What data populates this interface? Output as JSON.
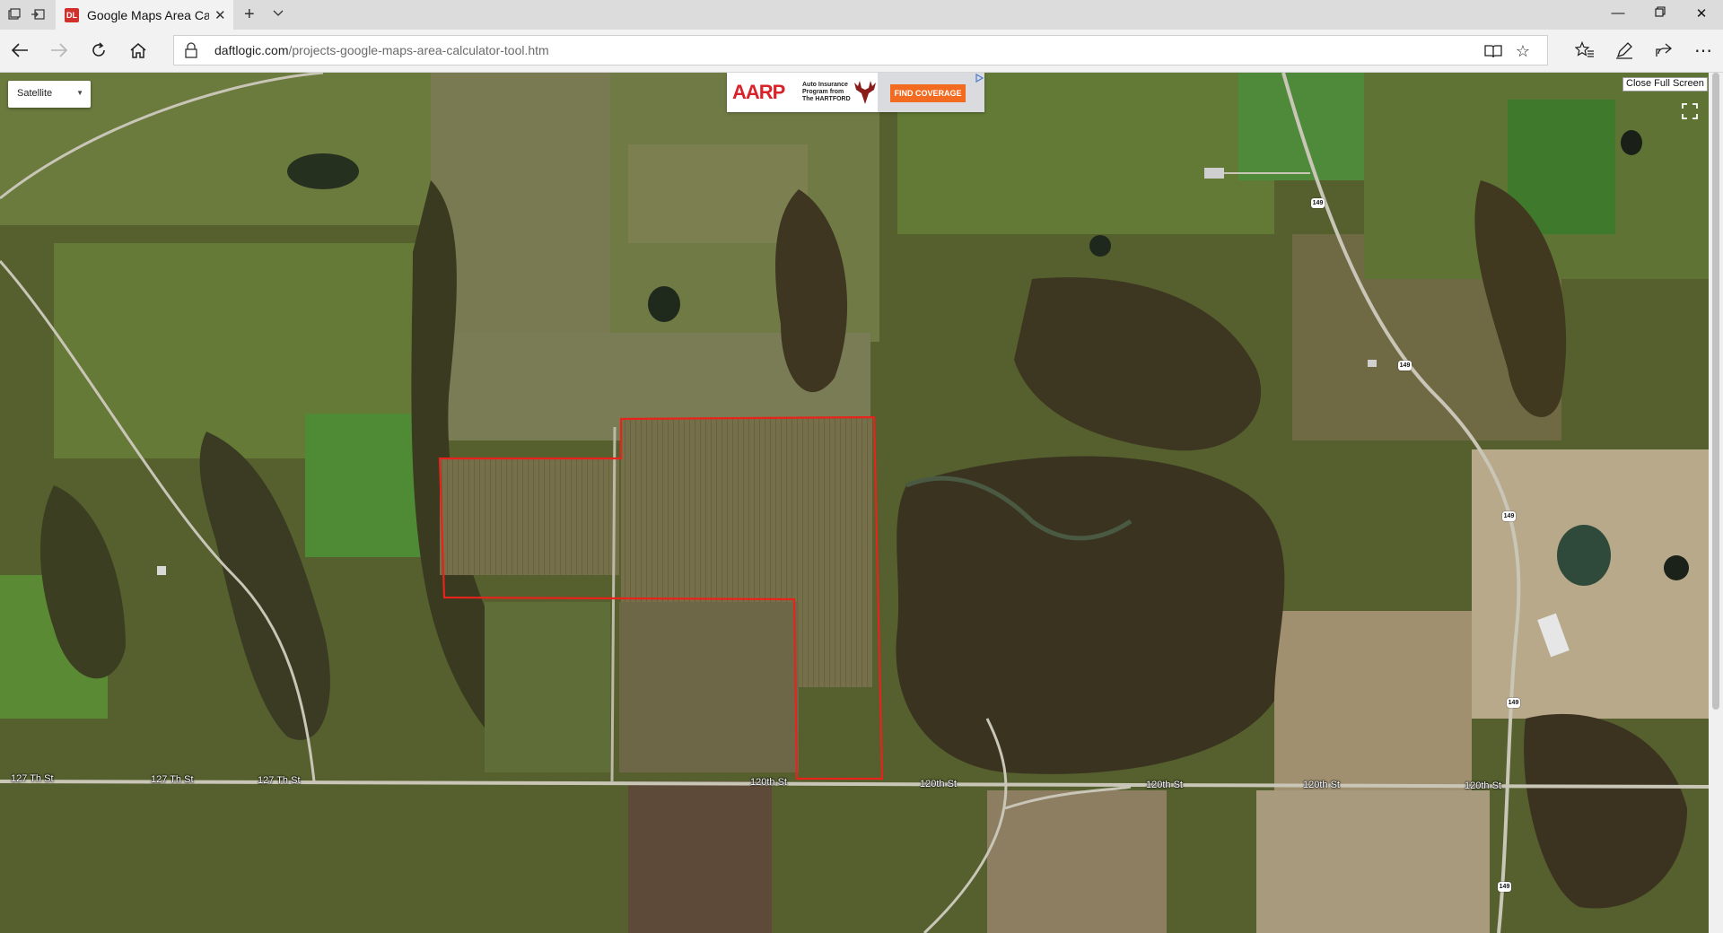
{
  "browser": {
    "tab_title": "Google Maps Area Calc",
    "tab_icon": "dl-favicon-icon",
    "favicon_text": "DL",
    "url_domain": "daftlogic.com",
    "url_path": "/projects-google-maps-area-calculator-tool.htm"
  },
  "map": {
    "map_type": "Satellite",
    "close_fullscreen_label": "Close Full Screen",
    "ad": {
      "logo": "AARP",
      "program_text": "Auto Insurance Program from The HARTFORD",
      "button": "FIND COVERAGE"
    },
    "road_labels": {
      "r127_1": "127 Th St",
      "r127_2": "127 Th St",
      "r127_3": "127 Th St",
      "r120_1": "120th St",
      "r120_2": "120th St",
      "r120_3": "120th St",
      "r120_4": "120th St",
      "r120_5": "120th St"
    },
    "highway_shields": {
      "h1": "149",
      "h2": "149",
      "h3": "149",
      "h4": "149",
      "h5": "149"
    },
    "boundary_color": "#e8231b",
    "colors": {
      "field_brown": "#7d7448",
      "field_green": "#5c7a3a",
      "woods": "#3b3a1f",
      "road": "#c9c6b8"
    }
  }
}
